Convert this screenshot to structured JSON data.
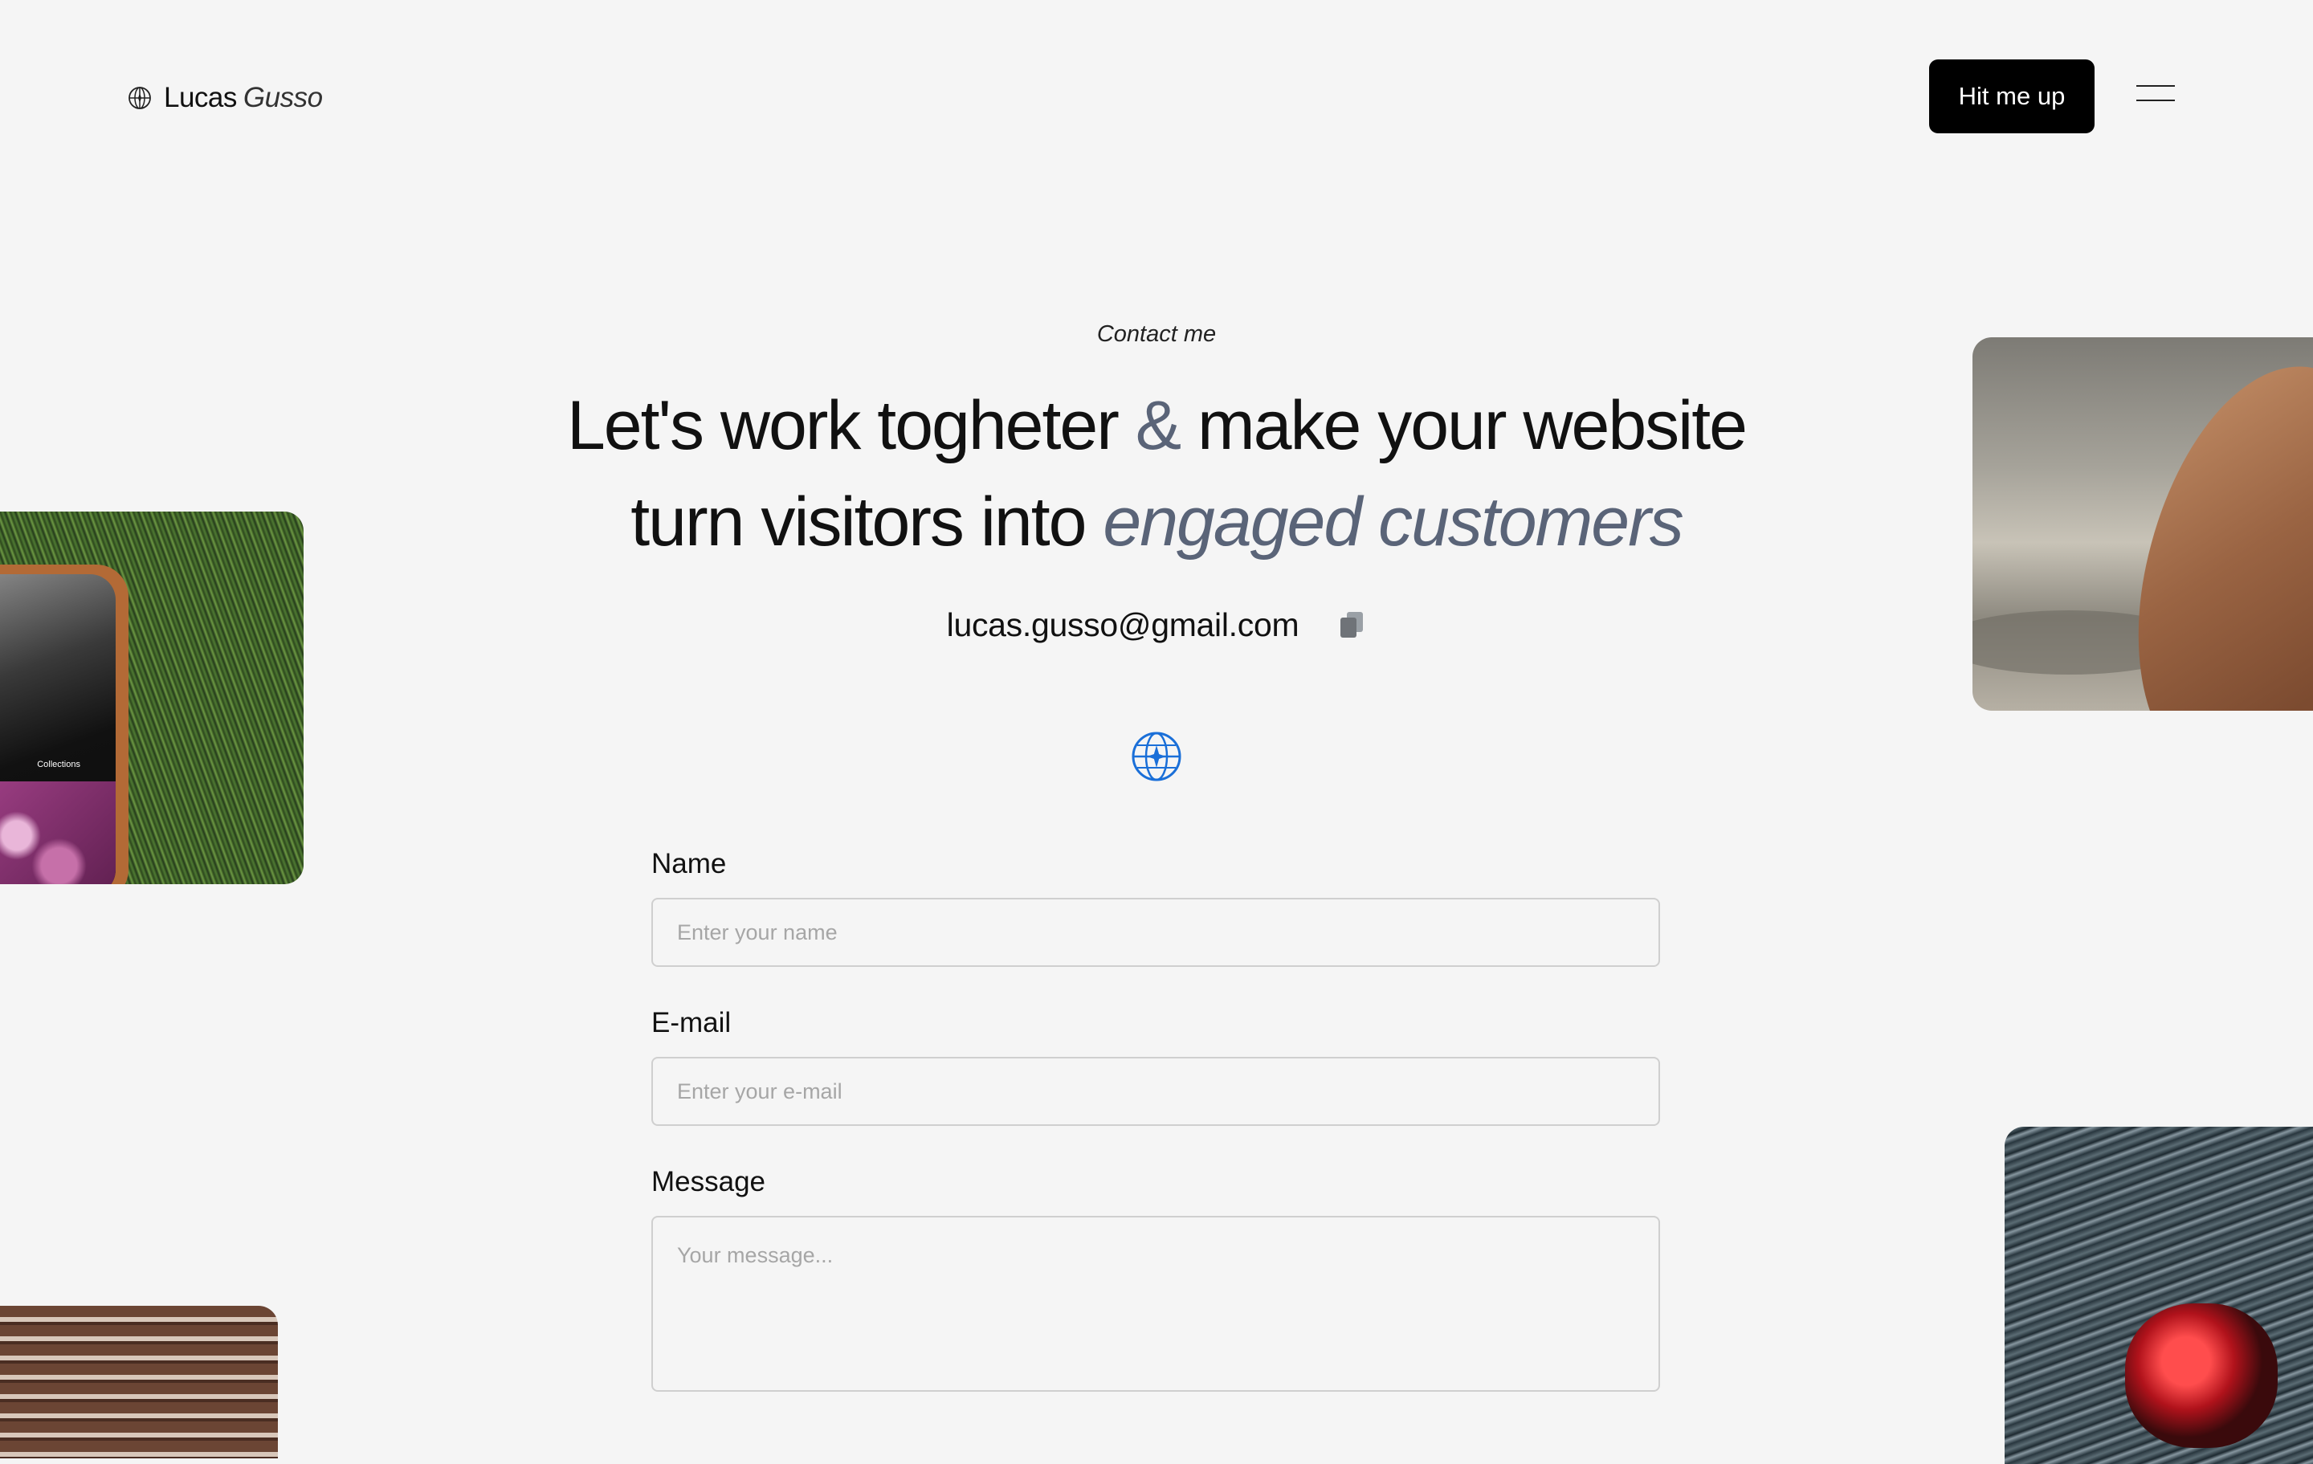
{
  "brand": {
    "first_name": "Lucas",
    "last_name": "Gusso",
    "logo_icon": "globe-crosshair-icon"
  },
  "header": {
    "cta_label": "Hit me up",
    "menu_icon": "hamburger-menu-icon"
  },
  "hero": {
    "eyebrow": "Contact me",
    "headline_part1": "Let's work togheter ",
    "headline_amp": "&",
    "headline_part2": " make your website",
    "headline_part3": "turn visitors into ",
    "headline_accent": "engaged customers",
    "email": "lucas.gusso@gmail.com",
    "copy_icon": "copy-icon",
    "divider_icon": "globe-icon"
  },
  "form": {
    "name_label": "Name",
    "name_placeholder": "Enter your name",
    "email_label": "E-mail",
    "email_placeholder": "Enter your e-mail",
    "message_label": "Message",
    "message_placeholder": "Your message..."
  },
  "photos": {
    "phone_tab_label": "Collections"
  },
  "colors": {
    "background": "#f5f5f5",
    "accent_text": "#5a6478",
    "globe_accent": "#1a6fd8",
    "button_bg": "#000000"
  }
}
